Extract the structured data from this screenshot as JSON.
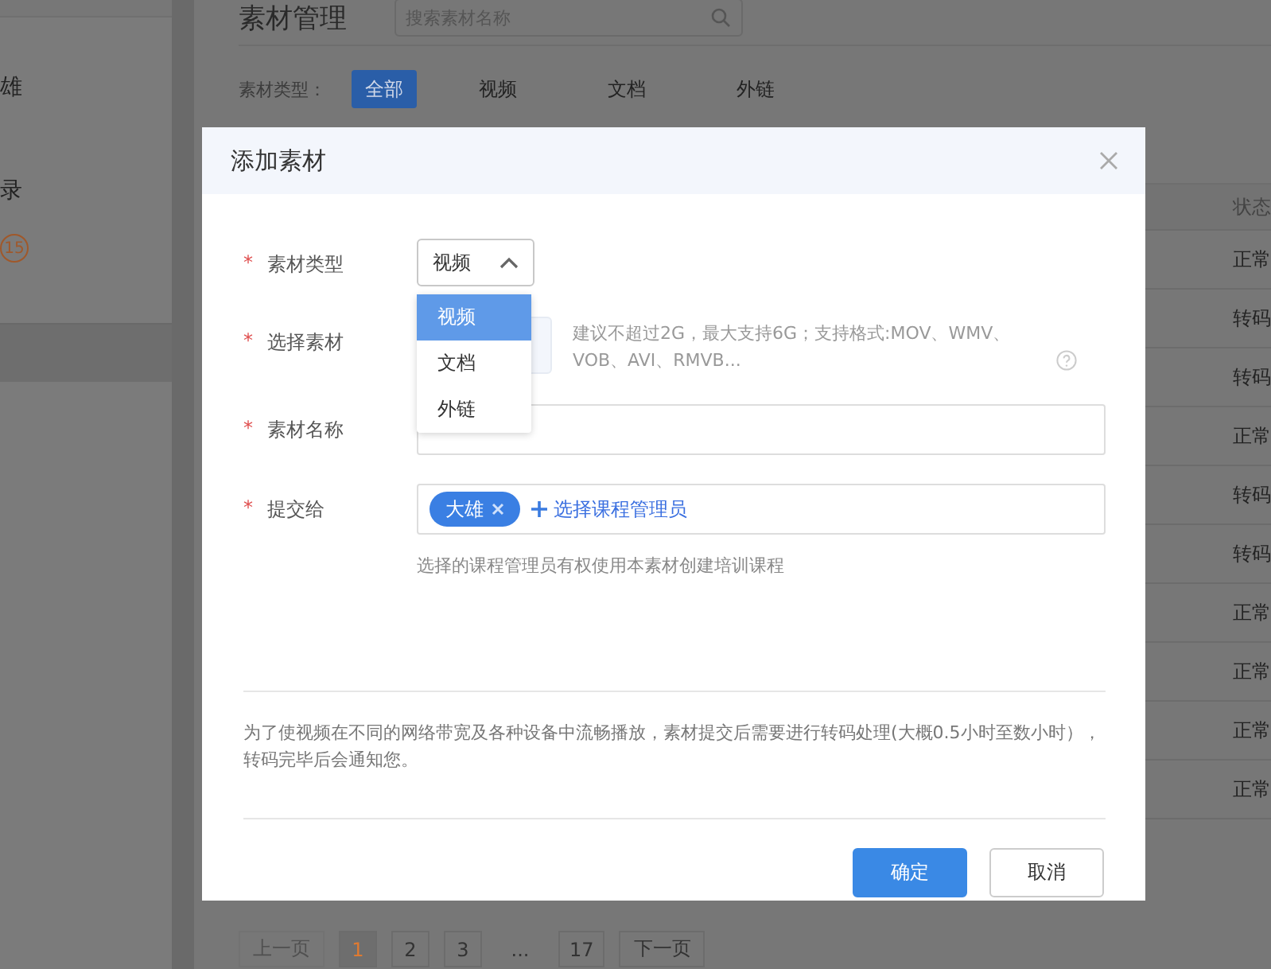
{
  "sidebar": {
    "items": [
      {
        "label": "雄"
      },
      {
        "label": "录",
        "badge": "15"
      }
    ]
  },
  "page": {
    "title": "素材管理",
    "search": {
      "placeholder": "搜索素材名称"
    }
  },
  "filter": {
    "label": "素材类型：",
    "options": [
      {
        "label": "全部",
        "selected": true
      },
      {
        "label": "视频",
        "selected": false
      },
      {
        "label": "文档",
        "selected": false
      },
      {
        "label": "外链",
        "selected": false
      }
    ]
  },
  "table": {
    "columns": [
      "状态"
    ],
    "rows": [
      {
        "status": "正常"
      },
      {
        "status": "转码"
      },
      {
        "status": "转码"
      },
      {
        "status": "正常"
      },
      {
        "status": "转码"
      },
      {
        "status": "转码"
      },
      {
        "status": "正常"
      },
      {
        "status": "正常"
      },
      {
        "status": "正常"
      },
      {
        "status": "正常"
      }
    ]
  },
  "pagination": {
    "items": [
      {
        "kind": "prev",
        "label": "上一页",
        "disabled": true
      },
      {
        "kind": "page",
        "label": "1",
        "selected": true
      },
      {
        "kind": "page",
        "label": "2",
        "selected": false
      },
      {
        "kind": "page",
        "label": "3",
        "selected": false
      },
      {
        "kind": "ellipsis",
        "label": "..."
      },
      {
        "kind": "page",
        "label": "17",
        "selected": false
      },
      {
        "kind": "next",
        "label": "下一页",
        "disabled": false
      }
    ]
  },
  "dialog": {
    "title": "添加素材",
    "fields": [
      {
        "kind": "select",
        "label": "素材类型",
        "required_mark": "*",
        "value": "视频",
        "expanded": true,
        "options": [
          {
            "label": "视频",
            "selected": true
          },
          {
            "label": "文档",
            "selected": false
          },
          {
            "label": "外链",
            "selected": false
          }
        ]
      },
      {
        "kind": "upload",
        "label": "选择素材",
        "required_mark": "*",
        "hint": "建议不超过2G，最大支持6G；支持格式:MOV、WMV、VOB、AVI、RMVB..."
      },
      {
        "kind": "text",
        "label": "素材名称",
        "required_mark": "*"
      },
      {
        "kind": "tags",
        "label": "提交给",
        "required_mark": "*",
        "tags": [
          {
            "label": "大雄"
          }
        ],
        "add_label": "选择课程管理员",
        "help": "选择的课程管理员有权使用本素材创建培训课程"
      }
    ],
    "note": "为了使视频在不同的网络带宽及各种设备中流畅播放，素材提交后需要进行转码处理(大概0.5小时至数小时），转码完毕后会通知您。",
    "buttons": [
      {
        "kind": "primary",
        "label": "确定"
      },
      {
        "kind": "default",
        "label": "取消"
      }
    ]
  }
}
